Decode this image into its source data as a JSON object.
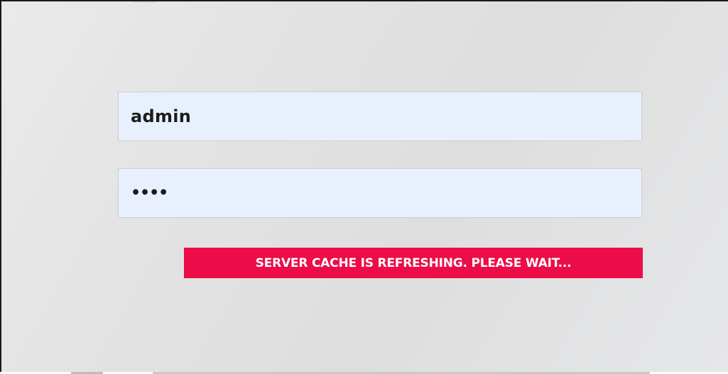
{
  "login": {
    "username_value": "admin",
    "password_value": "••••"
  },
  "status": {
    "message": "SERVER CACHE IS REFRESHING. PLEASE WAIT...",
    "color": "#ec0d48"
  },
  "colors": {
    "field_background": "#e9f0fd",
    "page_background": "#e2e2e2"
  }
}
